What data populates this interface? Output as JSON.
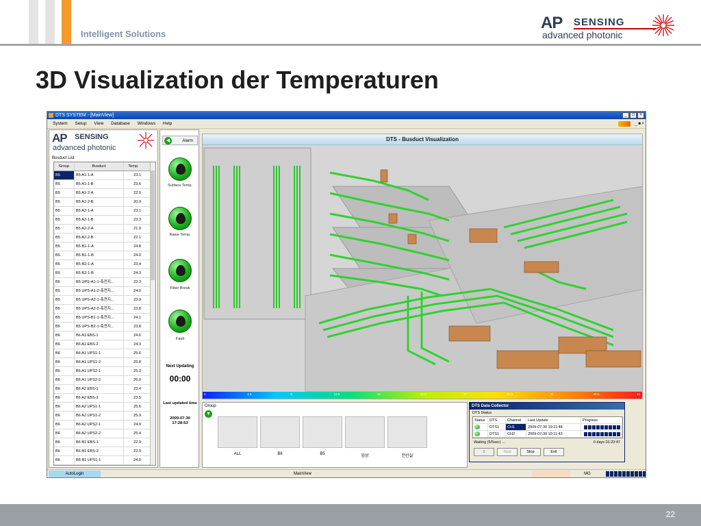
{
  "slide": {
    "tagline": "Intelligent Solutions",
    "title": "3D Visualization der Temperaturen",
    "logo": {
      "ap": "AP",
      "sensing": "SENSING",
      "subtitle": "advanced photonic"
    },
    "page_number": "22"
  },
  "app": {
    "window_title": "DTS SYSTEM - [MainView]",
    "menu": [
      "System",
      "Setup",
      "View",
      "Database",
      "Windows",
      "Help"
    ],
    "logo": {
      "ap": "AP",
      "sensing": "SENSING",
      "subtitle": "advanced photonic"
    },
    "busduct_list": {
      "label": "Busduct List",
      "columns": [
        "Group",
        "Busduct",
        "Temp."
      ],
      "rows": [
        [
          "B5",
          "B5 A1-1-A",
          "23.1"
        ],
        [
          "B5",
          "B5 A1-1-B",
          "23.6"
        ],
        [
          "B5",
          "B5 A1-2-A",
          "22.9"
        ],
        [
          "B5",
          "B5 A1-2-B",
          "20.9"
        ],
        [
          "B5",
          "B5 A2-1-A",
          "23.1"
        ],
        [
          "B5",
          "B5 A2-1-B",
          "23.3"
        ],
        [
          "B5",
          "B5 A2-2-A",
          "21.9"
        ],
        [
          "B5",
          "B5 A2-2-B",
          "22.1"
        ],
        [
          "B5",
          "B5 B1-1-A",
          "24.8"
        ],
        [
          "B5",
          "B5 B1-1-B",
          "24.0"
        ],
        [
          "B5",
          "B5 B2-1-A",
          "23.4"
        ],
        [
          "B5",
          "B5 B2-1-B",
          "24.3"
        ],
        [
          "B5",
          "B5 UPS-A1-1-축전지...",
          "23.3"
        ],
        [
          "B5",
          "B5 UPS-A1-2-축전지...",
          "24.0"
        ],
        [
          "B5",
          "B5 UPS-A2-1-축전지...",
          "23.9"
        ],
        [
          "B5",
          "B5 UPS-A2-2-축전지...",
          "23.8"
        ],
        [
          "B5",
          "B5 UPS-B1-1-축전지...",
          "24.1"
        ],
        [
          "B5",
          "B5 UPS-B2-1-축전지...",
          "23.8"
        ],
        [
          "B6",
          "B6 A1 EBS-1",
          "24.6"
        ],
        [
          "B6",
          "B6 A1 EBS-2",
          "24.3"
        ],
        [
          "B6",
          "B6 A1 UPS1-1",
          "25.6"
        ],
        [
          "B6",
          "B6 A1 UPS1-2",
          "25.8"
        ],
        [
          "B6",
          "B6 A1 UPS2-1",
          "25.3"
        ],
        [
          "B6",
          "B6 A1 UPS2-2",
          "26.0"
        ],
        [
          "B6",
          "B6 A2 EBS-1",
          "23.4"
        ],
        [
          "B6",
          "B6 A2 EBS-2",
          "23.5"
        ],
        [
          "B6",
          "B6 A2 UPS1-1",
          "25.6"
        ],
        [
          "B6",
          "B6 A2 UPS1-2",
          "25.9"
        ],
        [
          "B6",
          "B6 A2 UPS2-1",
          "24.9"
        ],
        [
          "B6",
          "B6 A2 UPS2-2",
          "25.4"
        ],
        [
          "B6",
          "B6 B1 EBS-1",
          "22.9"
        ],
        [
          "B6",
          "B6 B1 EBS-2",
          "22.9"
        ],
        [
          "B6",
          "B6 B1 UPS1-1",
          "24.0"
        ]
      ]
    },
    "side_buttons": {
      "alarm": "Alarm",
      "surface_temp": "Surface Temp.",
      "raise_temp": "Raise Temp.",
      "fiber_break": "Fiber Break",
      "fault": "Fault",
      "next_updating_label": "Next Updating",
      "next_updating_value": "00:00",
      "last_updated_label": "Last updated time",
      "last_updated_date": "2009-07-30",
      "last_updated_time": "17:28:53"
    },
    "visualization": {
      "title": "DTS - Busduct Visualization",
      "colorbar_ticks": [
        "0",
        "4.5",
        "9",
        "13.5",
        "18",
        "22.5",
        "27",
        "31.5",
        "36",
        "40.5",
        "45"
      ]
    },
    "group": {
      "label": "Group",
      "thumbs": [
        "ALL",
        "B6",
        "B5",
        "입상",
        "전산실"
      ]
    },
    "collector": {
      "title": "DTS Data Collector",
      "status_label": "DTS Status",
      "columns": [
        "Status",
        "DTS",
        "Channel",
        "Last Update",
        "Progress"
      ],
      "rows": [
        {
          "dts": "DTS1",
          "channel": "CH1",
          "last_update": "2009-07-30 19:11:48"
        },
        {
          "dts": "DTS1",
          "channel": "CH2",
          "last_update": "2009-07-30 19:11:43"
        }
      ],
      "waiting": "Waiting (5/5sec) ...",
      "elapsed": "0 days 01:23:47",
      "spin_value": "5",
      "start": "Start",
      "stop": "Stop",
      "exit": "Exit"
    },
    "statusbar": {
      "autologin": "AutoLogin",
      "mainview": "MainView",
      "mg": "MG"
    }
  },
  "colors": {
    "accent_orange": "#f39a2a",
    "tagline": "#7e93a9",
    "duct_green": "#2fd22f",
    "box_orange": "#c8874e",
    "selection": "#0a246a"
  }
}
